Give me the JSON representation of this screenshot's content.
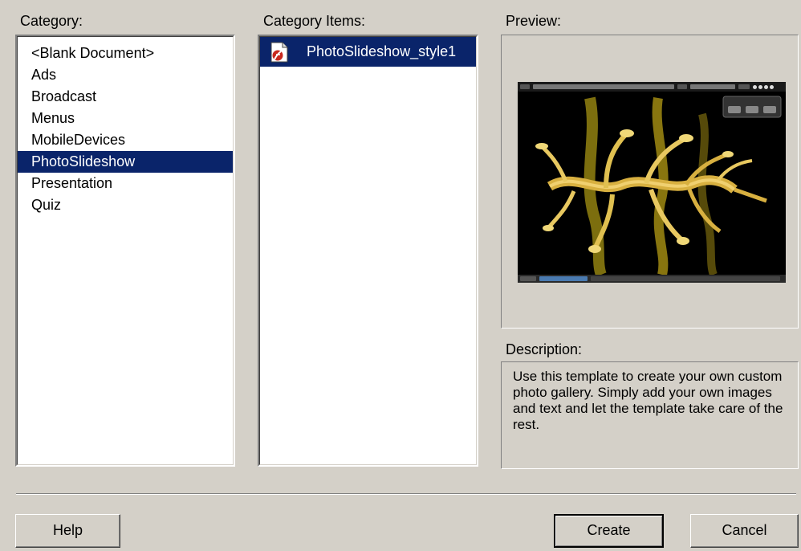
{
  "category": {
    "label": "Category:",
    "items": [
      {
        "label": "<Blank Document>"
      },
      {
        "label": "Ads"
      },
      {
        "label": "Broadcast"
      },
      {
        "label": "Menus"
      },
      {
        "label": "MobileDevices"
      },
      {
        "label": "PhotoSlideshow",
        "selected": true
      },
      {
        "label": "Presentation"
      },
      {
        "label": "Quiz"
      }
    ]
  },
  "category_items": {
    "label": "Category Items:",
    "items": [
      {
        "label": "PhotoSlideshow_style1",
        "icon": "flash-document-icon",
        "selected": true
      }
    ]
  },
  "preview": {
    "label": "Preview:"
  },
  "description": {
    "label": "Description:",
    "text": "Use this template to create your own custom photo gallery. Simply add your own images and text and let the template take care of the rest."
  },
  "buttons": {
    "help": "Help",
    "create": "Create",
    "cancel": "Cancel"
  },
  "colors": {
    "dialog_bg": "#d4d0c8",
    "selection_bg": "#0a246a",
    "selection_fg": "#ffffff"
  }
}
